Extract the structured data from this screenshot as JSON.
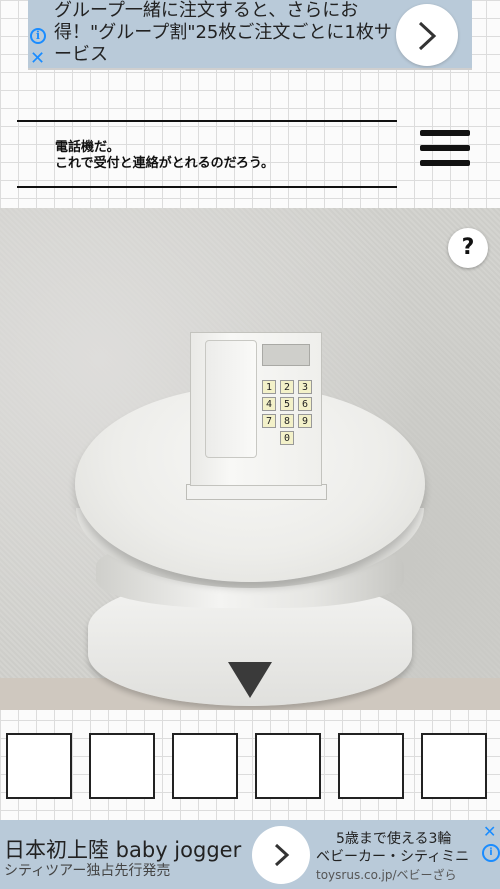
{
  "ad_top": {
    "text": "グループ一緒に注文すると、さらにお得！\"グループ割\"25枚ご注文ごとに1枚サービス",
    "info_glyph": "i",
    "close_glyph": "✕"
  },
  "message": {
    "line1": "電話機だ。",
    "line2": "これで受付と連絡がとれるのだろう。"
  },
  "scene": {
    "help_label": "?",
    "keypad_keys": [
      "1",
      "2",
      "3",
      "4",
      "5",
      "6",
      "7",
      "8",
      "9",
      "0"
    ]
  },
  "inventory": {
    "slot_count": 6
  },
  "ad_bottom": {
    "headline": "日本初上陸 baby jogger",
    "subline": "シティツアー独占先行発売",
    "right_line1": "5歳まで使える3輪",
    "right_line2": "ベビーカー・シティミニ",
    "right_url": "toysrus.co.jp/ベビーざら",
    "info_glyph": "i",
    "close_glyph": "✕"
  },
  "colors": {
    "ad_background": "#b9cad9",
    "accent_blue": "#1a8cff",
    "keypad_key": "#f3f1c9"
  }
}
